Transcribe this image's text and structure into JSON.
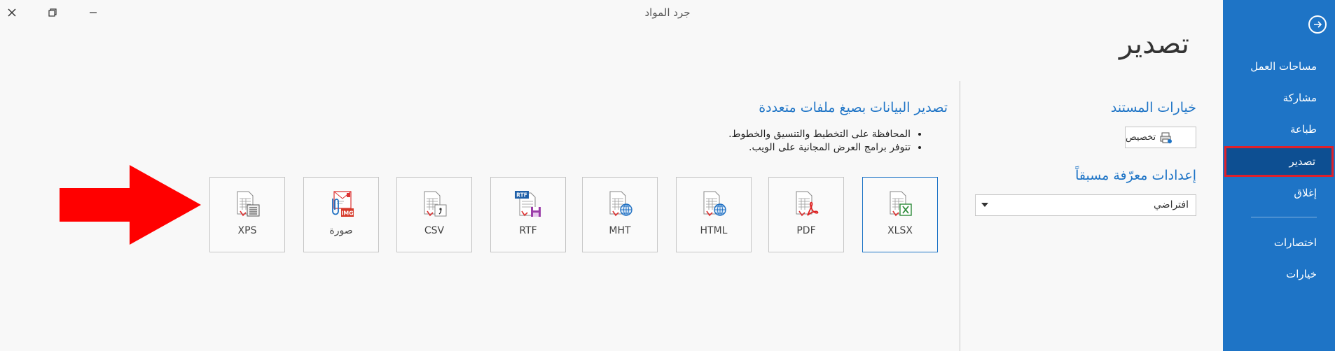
{
  "window": {
    "title": "جرد المواد"
  },
  "sidebar": {
    "items": [
      {
        "label": "مساحات العمل"
      },
      {
        "label": "مشاركة"
      },
      {
        "label": "طباعة"
      },
      {
        "label": "تصدير"
      },
      {
        "label": "إغلاق"
      },
      {
        "label": "اختصارات"
      },
      {
        "label": "خيارات"
      }
    ]
  },
  "page": {
    "title": "تصدير"
  },
  "document_options": {
    "heading": "خيارات المستند",
    "customize_label": "تخصيص",
    "presets_heading": "إعدادات معرّفة مسبقاً",
    "preset_value": "افتراضي"
  },
  "export": {
    "heading": "تصدير البيانات بصيغ ملفات متعددة",
    "bullets": [
      "المحافظة على التخطيط والتنسيق والخطوط.",
      "تتوفر برامج العرض المجانية على الويب."
    ],
    "formats": [
      {
        "label": "XLSX"
      },
      {
        "label": "PDF"
      },
      {
        "label": "HTML"
      },
      {
        "label": "MHT"
      },
      {
        "label": "RTF"
      },
      {
        "label": "CSV"
      },
      {
        "label": "صورة"
      },
      {
        "label": "XPS"
      }
    ]
  },
  "colors": {
    "sidebar": "#1e74c6",
    "sidebar_active": "#0d4f92",
    "highlight": "#e0202a",
    "accent": "#1e74c6",
    "arrow": "#ff0000"
  }
}
